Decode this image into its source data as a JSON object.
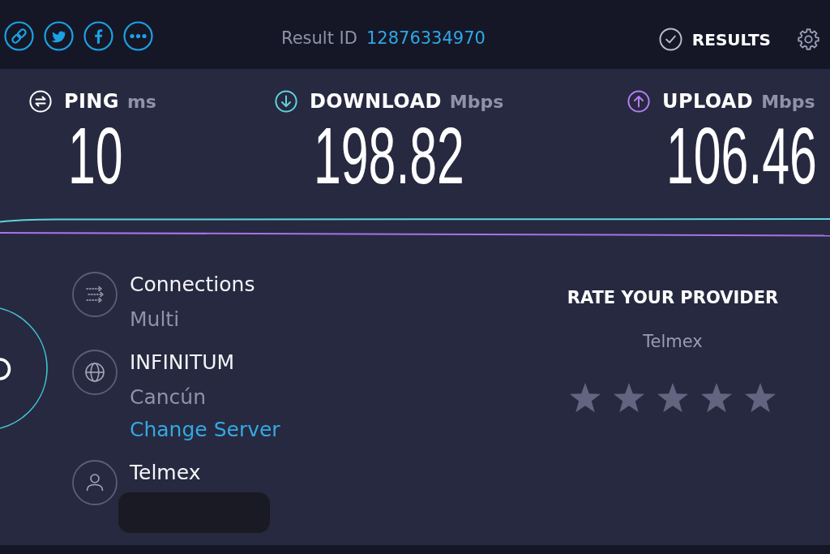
{
  "header": {
    "result_id_label": "Result ID",
    "result_id": "12876334970",
    "results_button": "RESULTS"
  },
  "metrics": [
    {
      "kind": "ping",
      "label": "PING",
      "unit": "ms",
      "value": "10"
    },
    {
      "kind": "download",
      "label": "DOWNLOAD",
      "unit": "Mbps",
      "value": "198.82"
    },
    {
      "kind": "upload",
      "label": "UPLOAD",
      "unit": "Mbps",
      "value": "106.46"
    }
  ],
  "connections": {
    "title": "Connections",
    "value": "Multi"
  },
  "server": {
    "name": "INFINITUM",
    "location": "Cancún",
    "link": "Change Server"
  },
  "provider": {
    "name": "Telmex"
  },
  "rating": {
    "title": "RATE YOUR PROVIDER",
    "provider": "Telmex"
  }
}
